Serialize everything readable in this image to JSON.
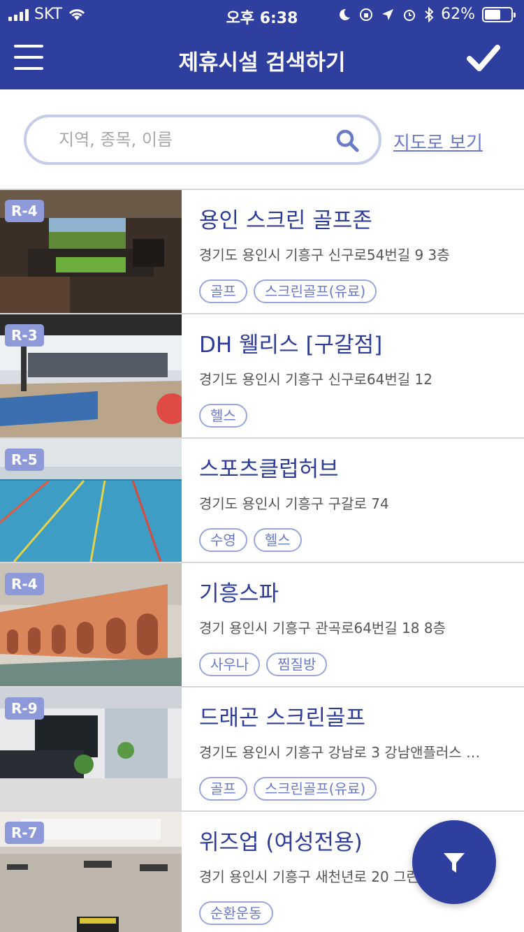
{
  "status_bar": {
    "carrier": "SKT",
    "time": "오후 6:38",
    "battery": "62%",
    "battery_level": 0.62
  },
  "header": {
    "title": "제휴시설 검색하기",
    "menu_icon": "hamburger-menu-icon",
    "confirm_icon": "checkmark-icon"
  },
  "search": {
    "placeholder": "지역, 종목, 이름",
    "value": "",
    "map_link": "지도로 보기"
  },
  "facilities": [
    {
      "badge": "R-4",
      "name": "용인 스크린 골프존",
      "address": "경기도 용인시 기흥구 신구로54번길 9 3층",
      "tags": [
        "골프",
        "스크린골프(유료)"
      ]
    },
    {
      "badge": "R-3",
      "name": "DH 웰리스 [구갈점]",
      "address": "경기도 용인시 기흥구 신구로64번길 12",
      "tags": [
        "헬스"
      ]
    },
    {
      "badge": "R-5",
      "name": "스포츠클럽허브",
      "address": "경기도 용인시 기흥구 구갈로 74",
      "tags": [
        "수영",
        "헬스"
      ]
    },
    {
      "badge": "R-4",
      "name": "기흥스파",
      "address": "경기 용인시 기흥구 관곡로64번길 18 8층",
      "tags": [
        "사우나",
        "찜질방"
      ]
    },
    {
      "badge": "R-9",
      "name": "드래곤 스크린골프",
      "address": "경기도 용인시 기흥구 강남로 3 강남앤플러스 …",
      "tags": [
        "골프",
        "스크린골프(유료)"
      ]
    },
    {
      "badge": "R-7",
      "name": "위즈업 (여성전용)",
      "address": "경기 용인시 기흥구 새천년로 20 그린프라자 4층",
      "tags": [
        "순환운동"
      ]
    }
  ],
  "fab": {
    "icon": "filter-icon"
  },
  "colors": {
    "primary": "#2f3f9f",
    "accent": "#6a79c8",
    "badge": "#8d99d8"
  }
}
